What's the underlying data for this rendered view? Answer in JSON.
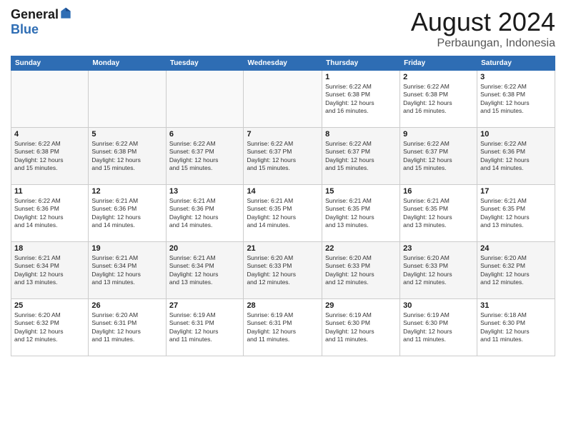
{
  "logo": {
    "general": "General",
    "blue": "Blue"
  },
  "header": {
    "month": "August 2024",
    "location": "Perbaungan, Indonesia"
  },
  "weekdays": [
    "Sunday",
    "Monday",
    "Tuesday",
    "Wednesday",
    "Thursday",
    "Friday",
    "Saturday"
  ],
  "weeks": [
    [
      {
        "day": "",
        "info": ""
      },
      {
        "day": "",
        "info": ""
      },
      {
        "day": "",
        "info": ""
      },
      {
        "day": "",
        "info": ""
      },
      {
        "day": "1",
        "info": "Sunrise: 6:22 AM\nSunset: 6:38 PM\nDaylight: 12 hours\nand 16 minutes."
      },
      {
        "day": "2",
        "info": "Sunrise: 6:22 AM\nSunset: 6:38 PM\nDaylight: 12 hours\nand 16 minutes."
      },
      {
        "day": "3",
        "info": "Sunrise: 6:22 AM\nSunset: 6:38 PM\nDaylight: 12 hours\nand 15 minutes."
      }
    ],
    [
      {
        "day": "4",
        "info": "Sunrise: 6:22 AM\nSunset: 6:38 PM\nDaylight: 12 hours\nand 15 minutes."
      },
      {
        "day": "5",
        "info": "Sunrise: 6:22 AM\nSunset: 6:38 PM\nDaylight: 12 hours\nand 15 minutes."
      },
      {
        "day": "6",
        "info": "Sunrise: 6:22 AM\nSunset: 6:37 PM\nDaylight: 12 hours\nand 15 minutes."
      },
      {
        "day": "7",
        "info": "Sunrise: 6:22 AM\nSunset: 6:37 PM\nDaylight: 12 hours\nand 15 minutes."
      },
      {
        "day": "8",
        "info": "Sunrise: 6:22 AM\nSunset: 6:37 PM\nDaylight: 12 hours\nand 15 minutes."
      },
      {
        "day": "9",
        "info": "Sunrise: 6:22 AM\nSunset: 6:37 PM\nDaylight: 12 hours\nand 15 minutes."
      },
      {
        "day": "10",
        "info": "Sunrise: 6:22 AM\nSunset: 6:36 PM\nDaylight: 12 hours\nand 14 minutes."
      }
    ],
    [
      {
        "day": "11",
        "info": "Sunrise: 6:22 AM\nSunset: 6:36 PM\nDaylight: 12 hours\nand 14 minutes."
      },
      {
        "day": "12",
        "info": "Sunrise: 6:21 AM\nSunset: 6:36 PM\nDaylight: 12 hours\nand 14 minutes."
      },
      {
        "day": "13",
        "info": "Sunrise: 6:21 AM\nSunset: 6:36 PM\nDaylight: 12 hours\nand 14 minutes."
      },
      {
        "day": "14",
        "info": "Sunrise: 6:21 AM\nSunset: 6:35 PM\nDaylight: 12 hours\nand 14 minutes."
      },
      {
        "day": "15",
        "info": "Sunrise: 6:21 AM\nSunset: 6:35 PM\nDaylight: 12 hours\nand 13 minutes."
      },
      {
        "day": "16",
        "info": "Sunrise: 6:21 AM\nSunset: 6:35 PM\nDaylight: 12 hours\nand 13 minutes."
      },
      {
        "day": "17",
        "info": "Sunrise: 6:21 AM\nSunset: 6:35 PM\nDaylight: 12 hours\nand 13 minutes."
      }
    ],
    [
      {
        "day": "18",
        "info": "Sunrise: 6:21 AM\nSunset: 6:34 PM\nDaylight: 12 hours\nand 13 minutes."
      },
      {
        "day": "19",
        "info": "Sunrise: 6:21 AM\nSunset: 6:34 PM\nDaylight: 12 hours\nand 13 minutes."
      },
      {
        "day": "20",
        "info": "Sunrise: 6:21 AM\nSunset: 6:34 PM\nDaylight: 12 hours\nand 13 minutes."
      },
      {
        "day": "21",
        "info": "Sunrise: 6:20 AM\nSunset: 6:33 PM\nDaylight: 12 hours\nand 12 minutes."
      },
      {
        "day": "22",
        "info": "Sunrise: 6:20 AM\nSunset: 6:33 PM\nDaylight: 12 hours\nand 12 minutes."
      },
      {
        "day": "23",
        "info": "Sunrise: 6:20 AM\nSunset: 6:33 PM\nDaylight: 12 hours\nand 12 minutes."
      },
      {
        "day": "24",
        "info": "Sunrise: 6:20 AM\nSunset: 6:32 PM\nDaylight: 12 hours\nand 12 minutes."
      }
    ],
    [
      {
        "day": "25",
        "info": "Sunrise: 6:20 AM\nSunset: 6:32 PM\nDaylight: 12 hours\nand 12 minutes."
      },
      {
        "day": "26",
        "info": "Sunrise: 6:20 AM\nSunset: 6:31 PM\nDaylight: 12 hours\nand 11 minutes."
      },
      {
        "day": "27",
        "info": "Sunrise: 6:19 AM\nSunset: 6:31 PM\nDaylight: 12 hours\nand 11 minutes."
      },
      {
        "day": "28",
        "info": "Sunrise: 6:19 AM\nSunset: 6:31 PM\nDaylight: 12 hours\nand 11 minutes."
      },
      {
        "day": "29",
        "info": "Sunrise: 6:19 AM\nSunset: 6:30 PM\nDaylight: 12 hours\nand 11 minutes."
      },
      {
        "day": "30",
        "info": "Sunrise: 6:19 AM\nSunset: 6:30 PM\nDaylight: 12 hours\nand 11 minutes."
      },
      {
        "day": "31",
        "info": "Sunrise: 6:18 AM\nSunset: 6:30 PM\nDaylight: 12 hours\nand 11 minutes."
      }
    ]
  ]
}
